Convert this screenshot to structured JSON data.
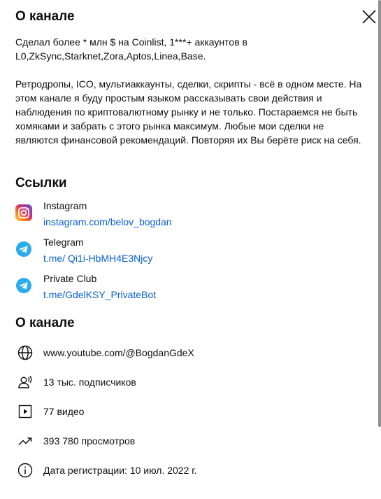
{
  "dialog": {
    "title": "О канале",
    "close_label": "×"
  },
  "description": {
    "paragraph1": "Сделал более * млн $ на Coinlist, 1***+ аккаунтов в L0,ZkSync,Starknet,Zora,Aptos,Linea,Base.",
    "paragraph2": "Ретродропы, ICO, мультиаккаунты, сделки, скрипты - всё в одном месте. На этом канале я буду простым языком рассказывать свои действия и наблюдения по криптовалютному рынку и не только. Постараемся не быть хомяками и забрать с этого рынка максимум. Любые мои сделки не являются финансовой рекомендаций. Повторяя их Вы берёте риск на себя."
  },
  "links": {
    "heading": "Ссылки",
    "items": [
      {
        "title": "Instagram",
        "url": "instagram.com/belov_bogdan",
        "icon": "instagram-icon"
      },
      {
        "title": "Telegram",
        "url": "t.me/ Qi1i-HbMH4E3Njcy",
        "icon": "telegram-icon"
      },
      {
        "title": "Private Club",
        "url": "t.me/GdelKSY_PrivateBot",
        "icon": "telegram-icon"
      }
    ]
  },
  "about": {
    "heading": "О канале",
    "channel_url": "www.youtube.com/@BogdanGdeX",
    "subscribers": "13 тыс. подписчиков",
    "videos": "77 видео",
    "views": "393 780 просмотров",
    "joined": "Дата регистрации: 10 июл. 2022 г."
  },
  "colors": {
    "link": "#065fd4",
    "telegram": "#2AABEE"
  }
}
